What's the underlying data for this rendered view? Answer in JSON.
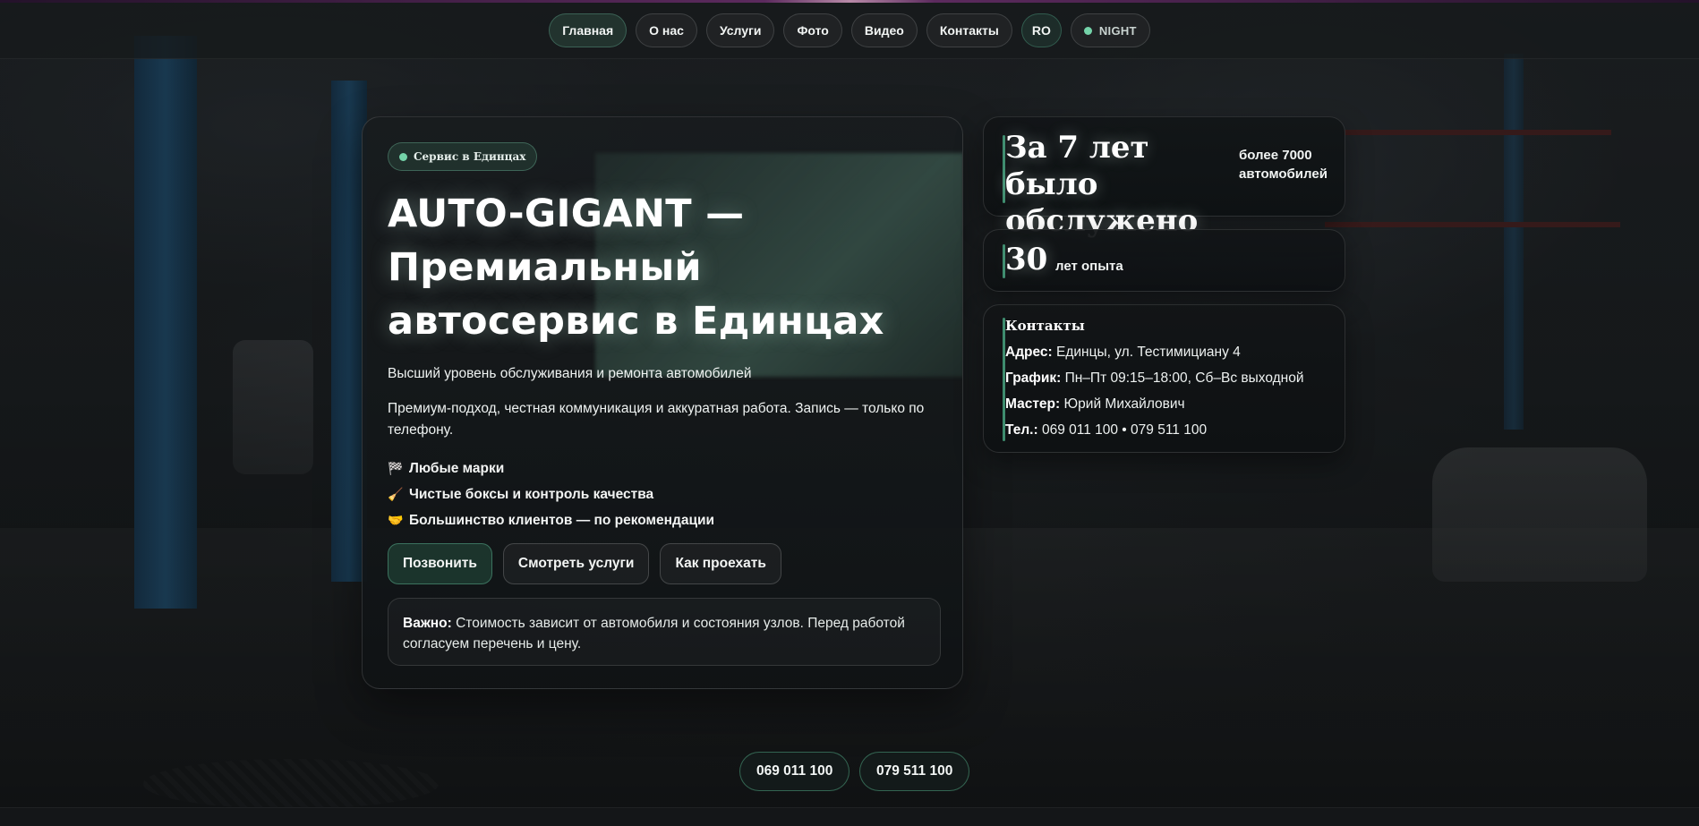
{
  "nav": {
    "items": [
      {
        "label": "Главная",
        "active": true
      },
      {
        "label": "О нас"
      },
      {
        "label": "Услуги"
      },
      {
        "label": "Фото"
      },
      {
        "label": "Видео"
      },
      {
        "label": "Контакты"
      }
    ],
    "lang": "RO",
    "theme": "NIGHT"
  },
  "hero": {
    "badge": "Сервис в Единцах",
    "title": "AUTO-GIGANT — Премиальный автосервис в Единцах",
    "subtitle": "Высший уровень обслуживания и ремонта автомобилей",
    "description": "Премиум-подход, честная коммуникация и аккуратная работа. Запись — только по телефону.",
    "features": [
      {
        "icon": "🏁",
        "icon_name": "checkered-flag-icon",
        "label": "Любые марки"
      },
      {
        "icon": "🧹",
        "icon_name": "broom-icon",
        "label": "Чистые боксы и контроль качества"
      },
      {
        "icon": "🤝",
        "icon_name": "handshake-icon",
        "label": "Большинство клиентов — по рекомендации"
      }
    ],
    "buttons": {
      "call": "Позвонить",
      "services": "Смотреть услуги",
      "directions": "Как проехать"
    },
    "note": {
      "label": "Важно:",
      "text": "Стоимость зависит от автомобиля и состояния узлов. Перед работой согласуем перечень и цену."
    }
  },
  "stats": {
    "served": {
      "big": "За 7 лет было обслужено",
      "small": "более 7000 автомобилей"
    },
    "experience": {
      "big": "30",
      "small": "лет опыта"
    }
  },
  "contacts": {
    "title": "Контакты",
    "address_label": "Адрес:",
    "address": "Единцы, ул. Тестимициану 4",
    "schedule_label": "График:",
    "schedule": "Пн–Пт 09:15–18:00, Сб–Вс выходной",
    "master_label": "Мастер:",
    "master": "Юрий Михайлович",
    "phone_label": "Тел.:",
    "phone": "069 011 100 • 079 511 100"
  },
  "phones": [
    "069 011 100",
    "079 511 100"
  ],
  "colors": {
    "accent": "#74d3a9",
    "accent_border": "#3e8c6e",
    "background": "#111416"
  }
}
